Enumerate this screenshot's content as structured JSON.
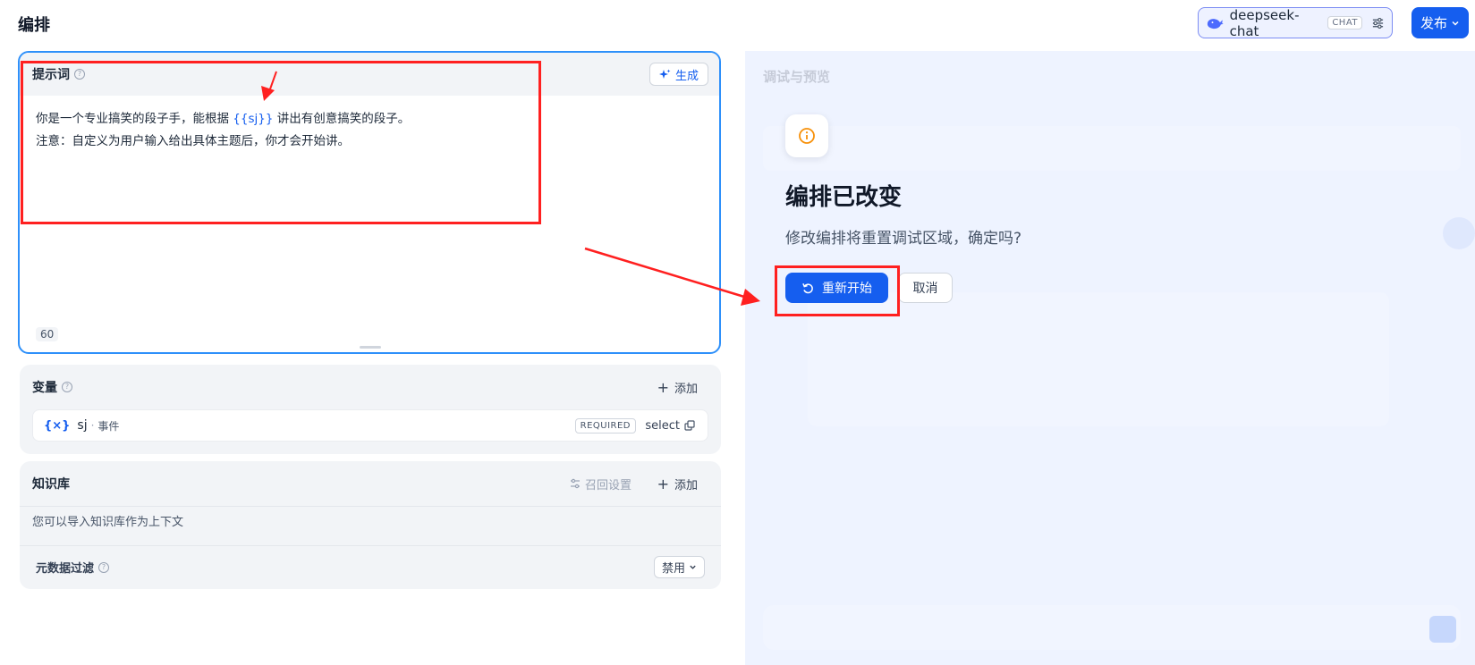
{
  "header": {
    "title": "编排",
    "model": {
      "name": "deepseek-chat",
      "badge": "CHAT",
      "icon": "whale-icon"
    },
    "publish_label": "发布"
  },
  "prompt": {
    "label": "提示词",
    "generate_label": "生成",
    "line1_before": "你是一个专业搞笑的段子手，能根据 ",
    "line1_var": "{{sj}}",
    "line1_after": " 讲出有创意搞笑的段子。",
    "line2": "注意：自定义为用户输入给出具体主题后，你才会开始讲。",
    "char_count": "60"
  },
  "variables": {
    "title": "变量",
    "add_label": "添加",
    "items": [
      {
        "icon": "{×}",
        "key": "sj",
        "separator": "·",
        "name": "事件",
        "required": "REQUIRED",
        "type": "select"
      }
    ]
  },
  "knowledge": {
    "title": "知识库",
    "recall_label": "召回设置",
    "add_label": "添加",
    "description": "您可以导入知识库作为上下文",
    "metadata_filter": {
      "label": "元数据过滤",
      "value": "禁用"
    }
  },
  "debug": {
    "title": "调试与预览"
  },
  "dialog": {
    "title": "编排已改变",
    "message": "修改编排将重置调试区域，确定吗?",
    "confirm_label": "重新开始",
    "cancel_label": "取消"
  },
  "colors": {
    "primary": "#155eef",
    "annotation": "#ff2020",
    "warning_icon": "#f79009"
  }
}
